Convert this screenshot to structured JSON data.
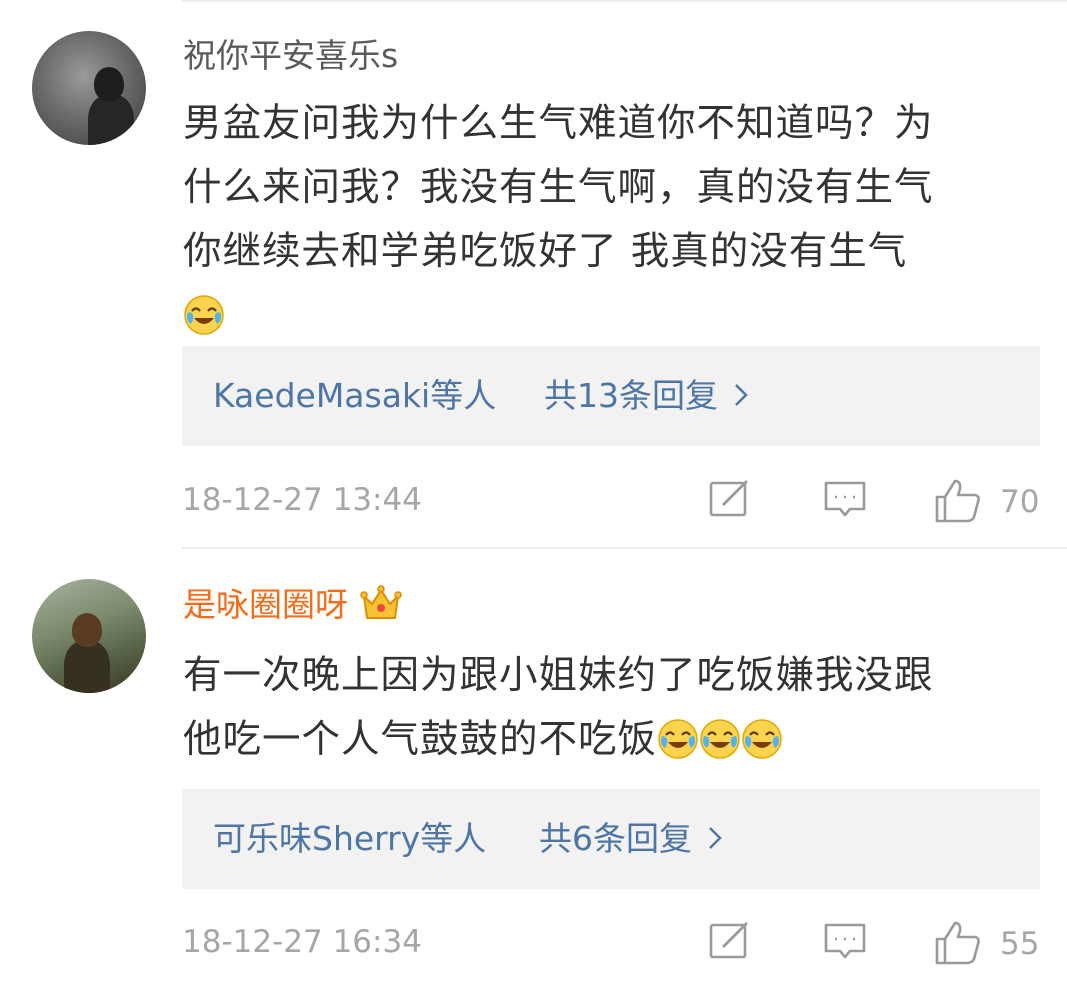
{
  "comments": [
    {
      "username": "祝你平安喜乐s",
      "is_vip": false,
      "content": "男盆友问我为什么生气难道你不知道吗？为什么来问我？我没有生气啊，真的没有生气你继续去和学弟吃饭好了 我真的没有生气",
      "content_lines": [
        "男盆友问我为什么生气难道你不知道吗？为",
        "什么来问我？我没有生气啊，真的没有生气",
        "你继续去和学弟吃饭好了 我真的没有生气"
      ],
      "emoji_count": 1,
      "emoji_name": "laugh-cry-emoji",
      "reply_users": "KaedeMasaki等人",
      "reply_count": "共13条回复",
      "timestamp": "18-12-27 13:44",
      "likes": "70"
    },
    {
      "username": "是咏圈圈呀",
      "is_vip": true,
      "content": "有一次晚上因为跟小姐妹约了吃饭嫌我没跟他吃一个人气鼓鼓的不吃饭",
      "content_lines": [
        "有一次晚上因为跟小姐妹约了吃饭嫌我没跟",
        "他吃一个人气鼓鼓的不吃饭"
      ],
      "emoji_count": 3,
      "emoji_name": "laugh-cry-emoji",
      "reply_users": "可乐味Sherry等人",
      "reply_count": "共6条回复",
      "timestamp": "18-12-27 16:34",
      "likes": "55"
    }
  ],
  "colors": {
    "username_default": "#5a5a5a",
    "username_vip": "#f36d1a",
    "link_blue": "#4d75a6",
    "meta_gray": "#a6a6a6",
    "text": "#333333",
    "reply_bg": "#f2f2f2"
  },
  "icons": [
    "edit-icon",
    "comment-icon",
    "like-icon",
    "chevron-right-icon",
    "crown-icon",
    "laugh-cry-emoji"
  ]
}
